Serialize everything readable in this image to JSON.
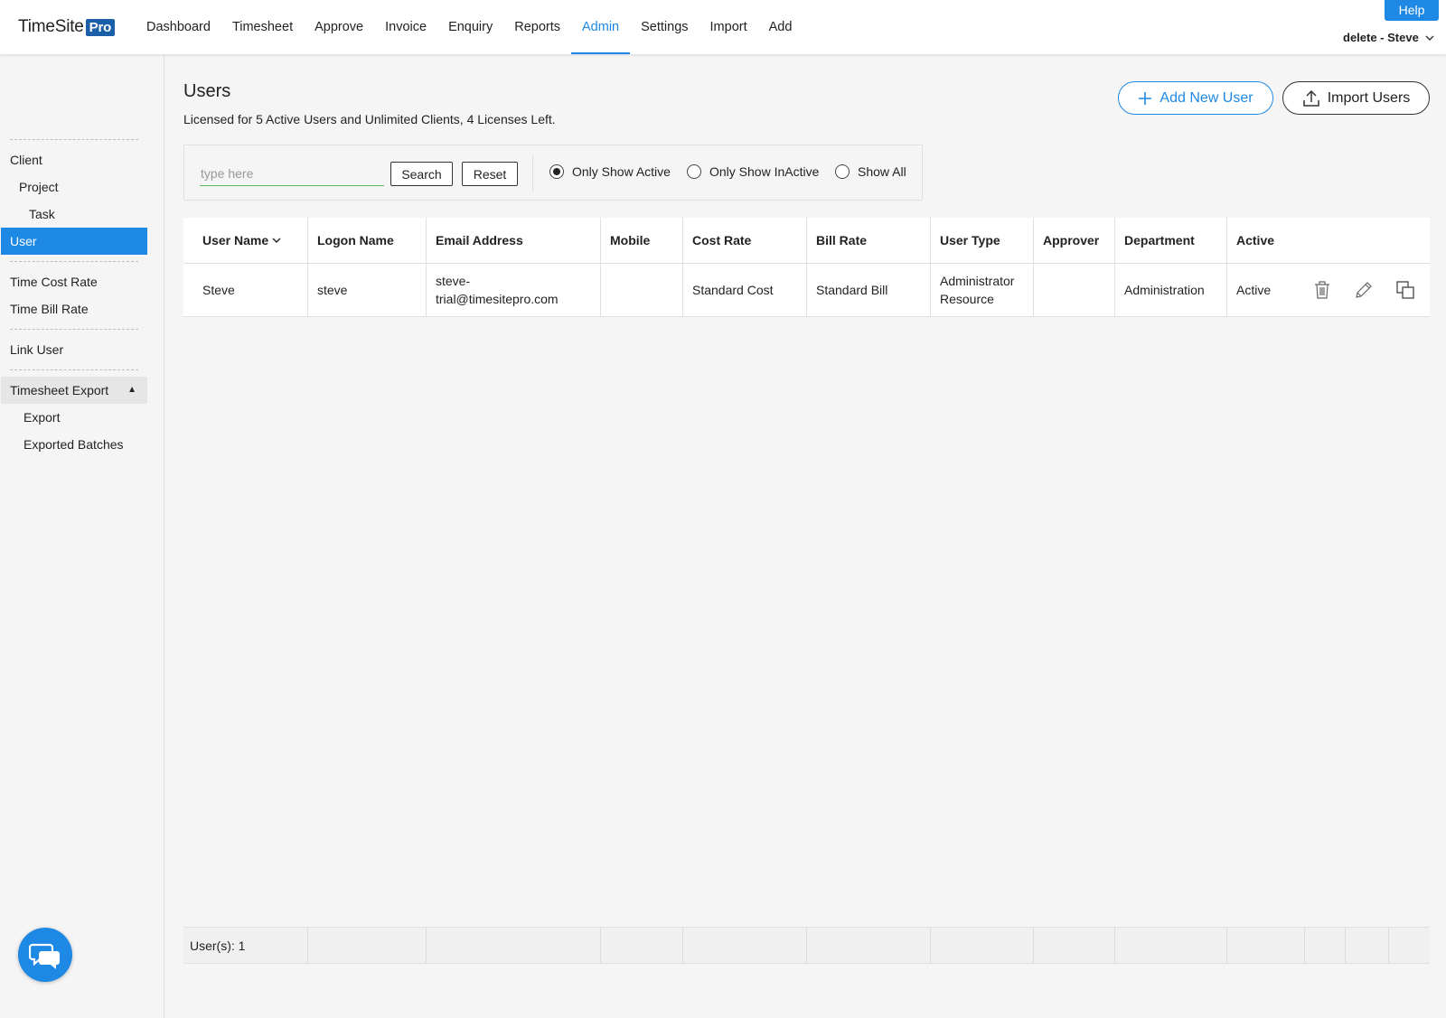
{
  "header": {
    "logo_text": "TimeSite",
    "logo_badge": "Pro",
    "nav": [
      {
        "label": "Dashboard"
      },
      {
        "label": "Timesheet"
      },
      {
        "label": "Approve"
      },
      {
        "label": "Invoice"
      },
      {
        "label": "Enquiry"
      },
      {
        "label": "Reports"
      },
      {
        "label": "Admin",
        "active": true
      },
      {
        "label": "Settings"
      },
      {
        "label": "Import"
      },
      {
        "label": "Add"
      }
    ],
    "help_label": "Help",
    "user_menu_label": "delete - Steve"
  },
  "sidebar": {
    "items": [
      {
        "label": "Client"
      },
      {
        "label": "Project"
      },
      {
        "label": "Task"
      },
      {
        "label": "User",
        "active": true
      },
      {
        "label": "Time Cost Rate"
      },
      {
        "label": "Time Bill Rate"
      },
      {
        "label": "Link User"
      },
      {
        "label": "Timesheet Export"
      },
      {
        "label": "Export"
      },
      {
        "label": "Exported Batches"
      }
    ]
  },
  "main": {
    "title": "Users",
    "license_text": "Licensed for 5 Active Users and Unlimited Clients, 4 Licenses Left.",
    "add_button": "Add New User",
    "import_button": "Import Users",
    "search": {
      "placeholder": "type here",
      "value": "",
      "search_label": "Search",
      "reset_label": "Reset"
    },
    "filters": [
      {
        "label": "Only Show Active",
        "checked": true
      },
      {
        "label": "Only Show InActive",
        "checked": false
      },
      {
        "label": "Show All",
        "checked": false
      }
    ]
  },
  "table": {
    "columns": [
      "User Name",
      "Logon Name",
      "Email Address",
      "Mobile",
      "Cost Rate",
      "Bill Rate",
      "User Type",
      "Approver",
      "Department",
      "Active"
    ],
    "rows": [
      {
        "user_name": "Steve",
        "logon_name": "steve",
        "email": "steve-trial@timesitepro.com",
        "email_line1": "steve-",
        "email_line2": "trial@timesitepro.com",
        "mobile": "",
        "cost_rate": "Standard Cost",
        "bill_rate": "Standard Bill",
        "user_type_line1": "Administrator",
        "user_type_line2": "Resource",
        "approver": "",
        "department": "Administration",
        "active": "Active"
      }
    ],
    "footer_count": "User(s): 1"
  },
  "colors": {
    "accent": "#1e88e5",
    "brand_badge": "#1b5fa8",
    "input_underline": "#5cb85c"
  },
  "icons": [
    "chevron-down-icon",
    "plus-icon",
    "upload-icon",
    "sort-chevron-icon",
    "trash-icon",
    "pencil-icon",
    "copy-icon",
    "chat-icon",
    "triangle-up-icon"
  ]
}
